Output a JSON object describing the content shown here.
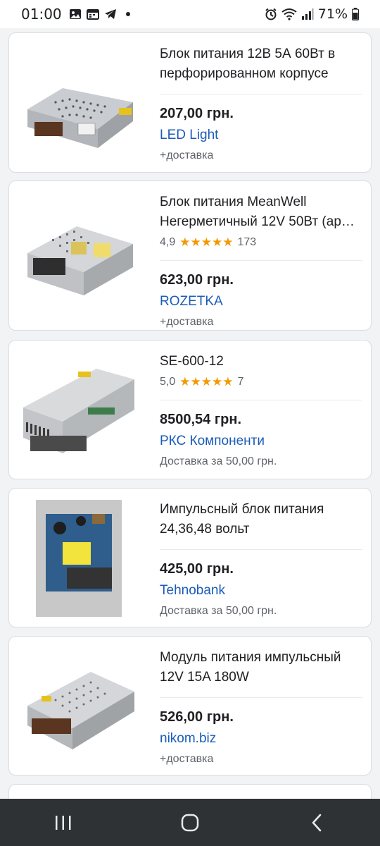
{
  "status_bar": {
    "time": "01:00",
    "battery": "71%"
  },
  "products": [
    {
      "title": "Блок питания 12В 5А 60Вт в перфорированном корпусе",
      "price": "207,00 грн.",
      "store": "LED Light",
      "shipping": "+доставка",
      "rating": null,
      "reviews": null,
      "image": "power-supply-enclosed"
    },
    {
      "title": "Блок питания MeanWell Негерметичный 12V 50Вт (ар…",
      "price": "623,00 грн.",
      "store": "ROZETKA",
      "shipping": "+доставка",
      "rating": "4,9",
      "reviews": "173",
      "image": "power-supply-meanwell"
    },
    {
      "title": "SE-600-12",
      "price": "8500,54 грн.",
      "store": "РКС Компоненти",
      "shipping": "Доставка за 50,00 грн.",
      "rating": "5,0",
      "reviews": "7",
      "image": "power-supply-large"
    },
    {
      "title": "Импульсный блок питания 24,36,48 вольт",
      "price": "425,00 грн.",
      "store": "Tehnobank",
      "shipping": "Доставка за 50,00 грн.",
      "rating": null,
      "reviews": null,
      "image": "pcb-board"
    },
    {
      "title": "Модуль питания импульсный 12V 15A 180W",
      "price": "526,00 грн.",
      "store": "nikom.biz",
      "shipping": "+доставка",
      "rating": null,
      "reviews": null,
      "image": "power-supply-perforated"
    }
  ],
  "stars": "★★★★★",
  "nav": {
    "recents": "recents-icon",
    "home": "home-icon",
    "back": "back-icon"
  }
}
